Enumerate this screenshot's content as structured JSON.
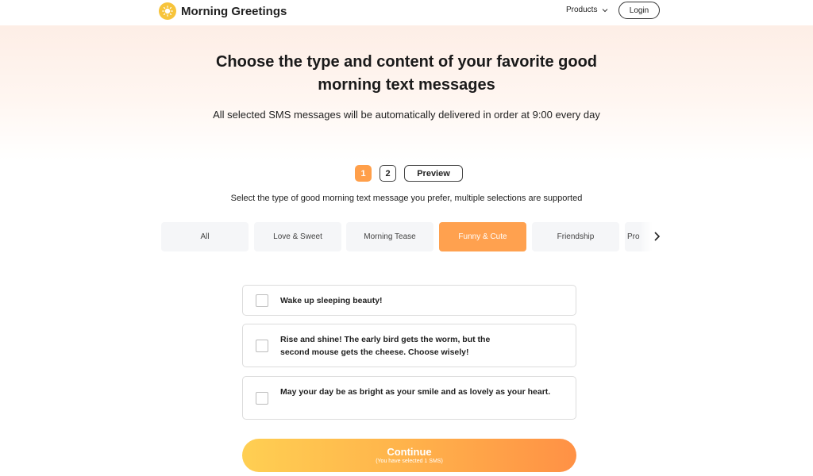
{
  "header": {
    "brand_name": "Morning Greetings",
    "products_label": "Products",
    "login_label": "Login"
  },
  "hero": {
    "title": "Choose the type and content of your favorite good morning text messages",
    "subtitle": "All selected SMS messages will be automatically delivered in order at 9:00 every day"
  },
  "steps": {
    "items": [
      "1",
      "2"
    ],
    "active": "1",
    "preview_label": "Preview"
  },
  "instruction": "Select the type of good morning text message you prefer, multiple selections are supported",
  "categories": {
    "items": [
      "All",
      "Love & Sweet",
      "Morning Tease",
      "Funny & Cute",
      "Friendship",
      "Pro"
    ],
    "selected": "Funny & Cute"
  },
  "messages": [
    {
      "text": "Wake up sleeping beauty!",
      "checked": false
    },
    {
      "text": "Rise and shine! The early bird gets the worm, but the second mouse gets the cheese. Choose wisely!",
      "checked": false
    },
    {
      "text": "May your day be as bright as your smile and as lovely as your heart.",
      "checked": false
    }
  ],
  "continue": {
    "label": "Continue",
    "selection_note": "(You have selected 1 SMS)"
  },
  "colors": {
    "accent": "#ffa14f",
    "gradient_start": "#ffcf52",
    "gradient_end": "#ff9145",
    "logo_yellow": "#f7c43b"
  }
}
